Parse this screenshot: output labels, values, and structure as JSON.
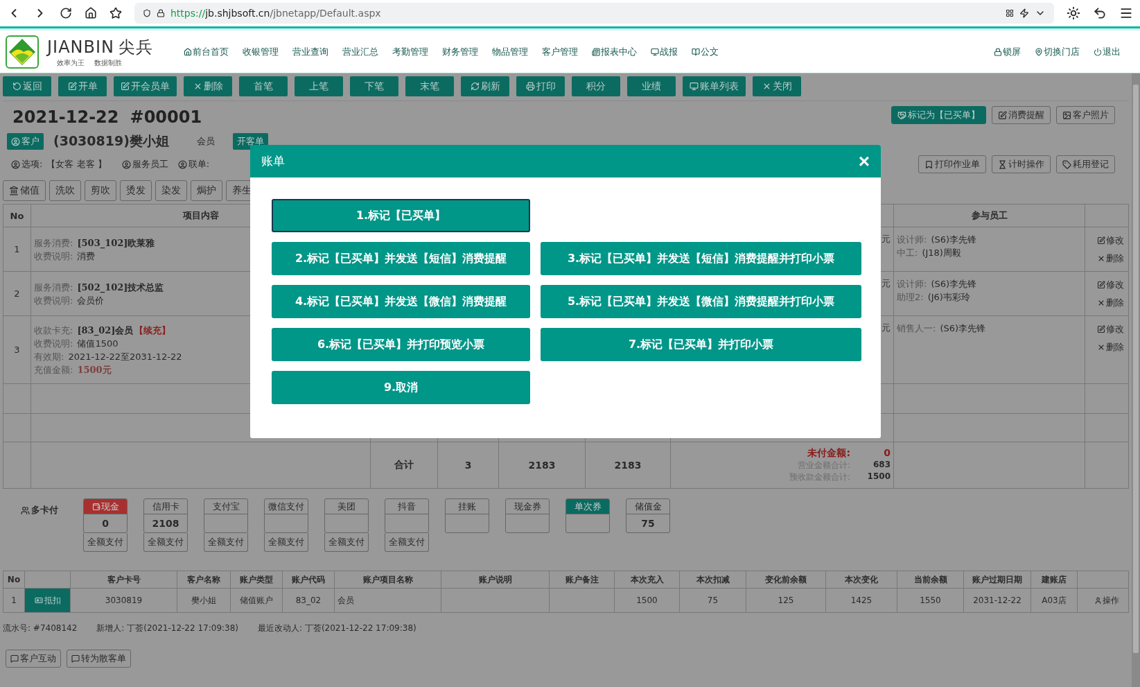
{
  "browser": {
    "url_scheme": "https://",
    "url_host": "jb.shjbsoft.cn",
    "url_path": "/jbnetapp/Default.aspx"
  },
  "header": {
    "brand": "JIANBIN",
    "brand_cn": "尖兵",
    "slogan": [
      "效率为王",
      "数据制胜"
    ],
    "nav": [
      "前台首页",
      "收银管理",
      "营业查询",
      "营业汇总",
      "考勤管理",
      "财务管理",
      "物品管理",
      "客户管理",
      "报表中心",
      "战报",
      "公文"
    ],
    "actions": [
      "锁屏",
      "切换门店",
      "退出"
    ]
  },
  "toolbar": [
    "返回",
    "开单",
    "开会员单",
    "删除",
    "首笔",
    "上笔",
    "下笔",
    "末笔",
    "刷新",
    "打印",
    "积分",
    "业绩",
    "账单列表",
    "关闭"
  ],
  "order": {
    "date": "2021-12-22",
    "number": "#00001",
    "actions": [
      {
        "label": "标记为【已买单】",
        "primary": true
      },
      {
        "label": "消费提醒",
        "primary": false
      },
      {
        "label": "客户照片",
        "primary": false
      }
    ],
    "customer_badge": "客户",
    "customer": "(3030819)樊小姐",
    "member_type": "会员",
    "open_guest": "开客单",
    "options_label": "选项:",
    "options": "【女客 老客 】",
    "service_staff": "服务员工",
    "linked": "联单:",
    "tools": [
      "打印作业单",
      "计时操作",
      "耗用登记"
    ]
  },
  "categories": [
    "储值",
    "洗吹",
    "剪吹",
    "烫发",
    "染发",
    "焗护",
    "养生"
  ],
  "items_table": {
    "columns": [
      "No",
      "项目内容",
      "参与员工"
    ],
    "rows": [
      {
        "no": "1",
        "lines": [
          {
            "label": "服务消费:",
            "value": "[503_102]欧莱雅",
            "kind": "title"
          },
          {
            "label": "收费说明:",
            "value": "消费",
            "kind": "plain"
          }
        ],
        "price_tail": "元",
        "staff": [
          {
            "role": "设计师:",
            "name": "(S6)李先锋"
          },
          {
            "role": "中工:",
            "name": "(J18)周毅"
          }
        ],
        "edit": "修改",
        "delete": "删除"
      },
      {
        "no": "2",
        "lines": [
          {
            "label": "服务消费:",
            "value": "[502_102]技术总监",
            "kind": "title"
          },
          {
            "label": "收费说明:",
            "value": "会员价",
            "kind": "plain"
          }
        ],
        "price_tail": "元",
        "staff": [
          {
            "role": "设计师:",
            "name": "(S6)李先锋"
          },
          {
            "role": "助理2:",
            "name": "(J6)韦彩玲"
          }
        ],
        "edit": "修改",
        "delete": "删除"
      },
      {
        "no": "3",
        "lines": [
          {
            "label": "收款卡充:",
            "value": "[83_02]会员",
            "kind": "title",
            "tag": "【续充】"
          },
          {
            "label": "收费说明:",
            "value": "储值1500",
            "kind": "plain"
          },
          {
            "label": "有效期:",
            "value": "2021-12-22至2031-12-22",
            "kind": "plain"
          },
          {
            "label": "充值金额:",
            "value": "1500元",
            "kind": "amount"
          }
        ],
        "price_tail": "元",
        "staff": [
          {
            "role": "销售人一:",
            "name": "(S6)李先锋"
          }
        ],
        "edit": "修改",
        "delete": "删除"
      }
    ],
    "totals": {
      "label": "合计",
      "count": "3",
      "amount_1": "2183",
      "amount_2": "2183",
      "unpaid_label": "未付金额:",
      "unpaid": "0",
      "revenue_label": "营业金额合计:",
      "revenue": "683",
      "prepaid_label": "预收款金额合计:",
      "prepaid": "1500"
    }
  },
  "payment": {
    "label": "多卡付",
    "methods": [
      {
        "name": "现金",
        "value": "0",
        "action": "全额支付",
        "color": "#a83030"
      },
      {
        "name": "信用卡",
        "value": "2108",
        "action": "全额支付"
      },
      {
        "name": "支付宝",
        "action": "全额支付"
      },
      {
        "name": "微信支付",
        "action": "全额支付"
      },
      {
        "name": "美团",
        "action": "全额支付"
      },
      {
        "name": "抖音",
        "action": "全额支付"
      },
      {
        "name": "挂账"
      },
      {
        "name": "现金券"
      },
      {
        "name": "单次券",
        "color": "#0b6b61"
      },
      {
        "name": "储值金",
        "value": "75"
      }
    ]
  },
  "accounts_table": {
    "columns": [
      "No",
      "",
      "客户卡号",
      "客户名称",
      "账户类型",
      "账户代码",
      "账户项目名称",
      "账户说明",
      "账户备注",
      "本次充入",
      "本次扣减",
      "变化前余额",
      "本次变化",
      "当前余额",
      "账户过期日期",
      "建账店",
      ""
    ],
    "rows": [
      [
        "1",
        "抵扣",
        "3030819",
        "樊小姐",
        "储值账户",
        "83_02",
        "会员",
        "",
        "",
        "1500",
        "75",
        "125",
        "1425",
        "1550",
        "2031-12-22",
        "A03店",
        "操作"
      ]
    ]
  },
  "footer": [
    "流水号: #7408142",
    "新增人: 丁荟(2021-12-22 17:09:38)",
    "最近改动人: 丁荟(2021-12-22 17:09:38)"
  ],
  "footer_buttons": [
    "客户互动",
    "转为散客单"
  ],
  "dialog": {
    "title": "账单",
    "close": "×",
    "options": [
      {
        "label": "1.标记【已买单】",
        "focused": true
      },
      {
        "label": "2.标记【已买单】并发送【短信】消费提醒",
        "focused": false
      },
      {
        "label": "3.标记【已买单】并发送【短信】消费提醒并打印小票",
        "focused": false
      },
      {
        "label": "4.标记【已买单】并发送【微信】消费提醒",
        "focused": false
      },
      {
        "label": "5.标记【已买单】并发送【微信】消费提醒并打印小票",
        "focused": false
      },
      {
        "label": "6.标记【已买单】并打印预览小票",
        "focused": false
      },
      {
        "label": "7.标记【已买单】并打印小票",
        "focused": false
      },
      {
        "label": "9.取消",
        "focused": false
      }
    ]
  }
}
